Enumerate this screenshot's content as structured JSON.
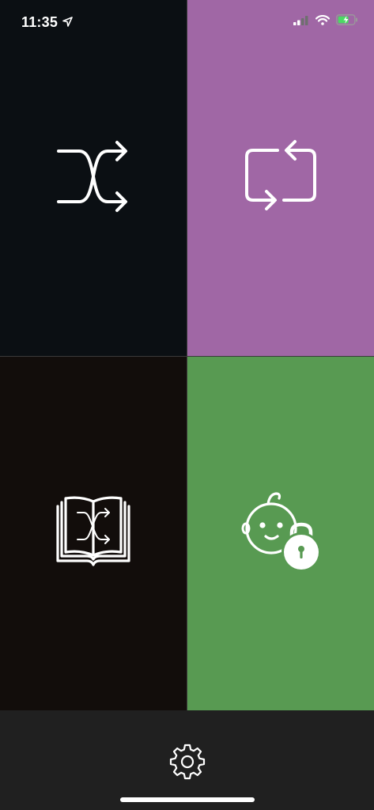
{
  "status_bar": {
    "time": "11:35",
    "location_icon": "location-arrow-icon",
    "signal_icon": "cellular-signal-icon",
    "wifi_icon": "wifi-icon",
    "battery_icon": "battery-charging-icon"
  },
  "tiles": [
    {
      "name": "shuffle",
      "icon": "shuffle-icon",
      "background": "#0b0f13"
    },
    {
      "name": "repeat",
      "icon": "repeat-icon",
      "background": "#a067a5"
    },
    {
      "name": "shuffle-book",
      "icon": "book-shuffle-icon",
      "background": "#120d0b"
    },
    {
      "name": "child-lock",
      "icon": "baby-lock-icon",
      "background": "#589a52"
    }
  ],
  "bottom_bar": {
    "settings_icon": "gear-icon",
    "background": "#202020"
  },
  "colors": {
    "icon_stroke": "#ffffff",
    "battery_fill": "#4cd964"
  }
}
